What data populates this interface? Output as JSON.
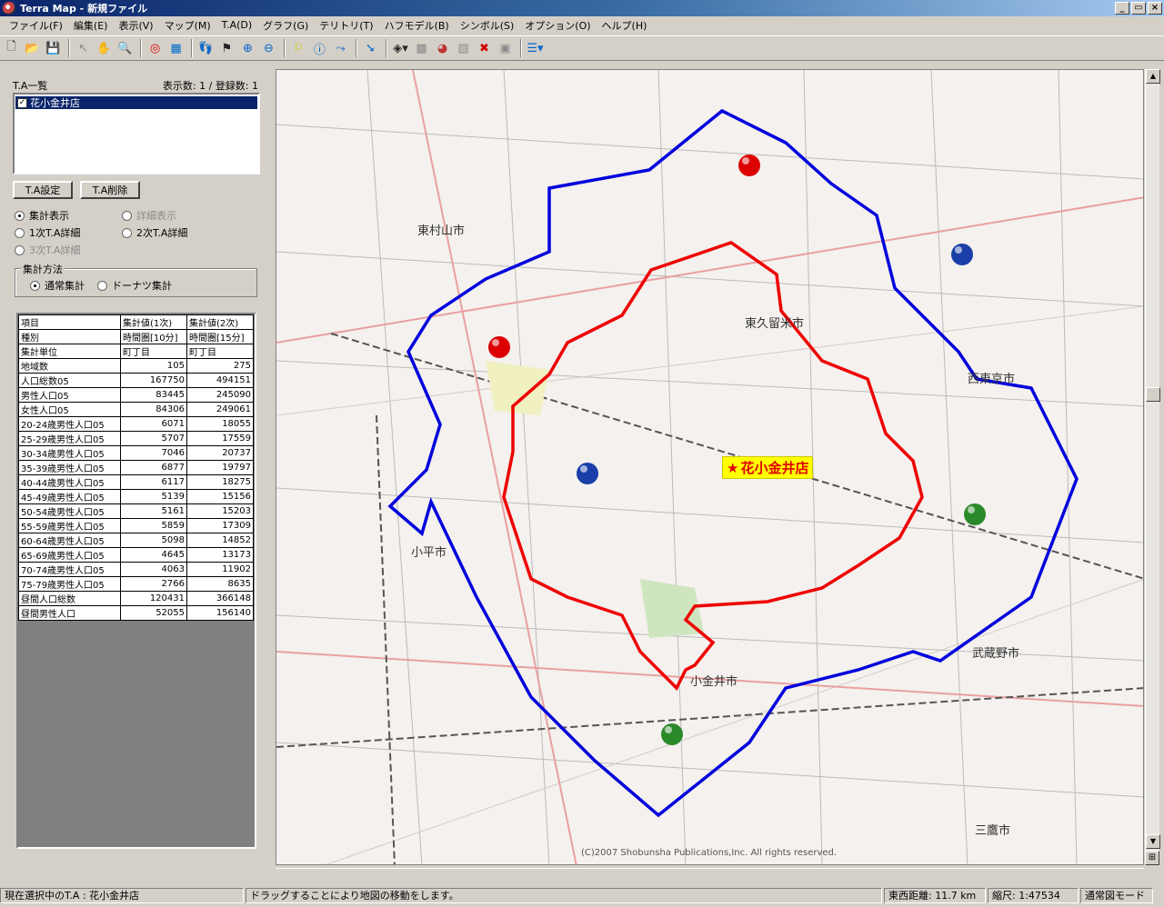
{
  "window": {
    "title": "Terra Map - 新規ファイル",
    "buttons": [
      "_",
      "▭",
      "×"
    ]
  },
  "menu": [
    "ファイル(F)",
    "編集(E)",
    "表示(V)",
    "マップ(M)",
    "T.A(D)",
    "グラフ(G)",
    "テリトリ(T)",
    "ハフモデル(B)",
    "シンボル(S)",
    "オプション(O)",
    "ヘルプ(H)"
  ],
  "toolbar": {
    "icons": [
      "new-file-icon",
      "open-folder-icon",
      "save-icon",
      "select-arrow-icon",
      "hand-pan-icon",
      "magnifier-icon",
      "target-icon",
      "calculator-icon",
      "footprints-icon",
      "signpost-icon",
      "zoom-in-icon",
      "zoom-out-icon",
      "flag-icon",
      "info-icon",
      "route-icon",
      "arrow-down-icon",
      "tag-icon",
      "grid-icon",
      "chart-icon",
      "symbol-icon",
      "cross-icon",
      "export-icon",
      "list-icon"
    ]
  },
  "ta_panel": {
    "title": "T.A一覧",
    "count_label": "表示数: 1 / 登録数: 1",
    "items": [
      {
        "name": "花小金井店",
        "checked": true
      }
    ],
    "btn_set": "T.A設定",
    "btn_delete": "T.A削除",
    "radios": {
      "summary": "集計表示",
      "detail": "詳細表示",
      "first_detail": "1次T.A詳細",
      "second_detail": "2次T.A詳細",
      "third_detail": "3次T.A詳細"
    },
    "method_label": "集計方法",
    "method_normal": "通常集計",
    "method_donut": "ドーナツ集計"
  },
  "stats_table": {
    "headers": [
      "項目",
      "集計値(1次)",
      "集計値(2次)"
    ],
    "rows": [
      [
        "種別",
        "時間圏[10分]",
        "時間圏[15分]"
      ],
      [
        "集計単位",
        "町丁目",
        "町丁目"
      ],
      [
        "地域数",
        "105",
        "275"
      ],
      [
        "人口総数05",
        "167750",
        "494151"
      ],
      [
        "男性人口05",
        "83445",
        "245090"
      ],
      [
        "女性人口05",
        "84306",
        "249061"
      ],
      [
        "20-24歳男性人口05",
        "6071",
        "18055"
      ],
      [
        "25-29歳男性人口05",
        "5707",
        "17559"
      ],
      [
        "30-34歳男性人口05",
        "7046",
        "20737"
      ],
      [
        "35-39歳男性人口05",
        "6877",
        "19797"
      ],
      [
        "40-44歳男性人口05",
        "6117",
        "18275"
      ],
      [
        "45-49歳男性人口05",
        "5139",
        "15156"
      ],
      [
        "50-54歳男性人口05",
        "5161",
        "15203"
      ],
      [
        "55-59歳男性人口05",
        "5859",
        "17309"
      ],
      [
        "60-64歳男性人口05",
        "5098",
        "14852"
      ],
      [
        "65-69歳男性人口05",
        "4645",
        "13173"
      ],
      [
        "70-74歳男性人口05",
        "4063",
        "11902"
      ],
      [
        "75-79歳男性人口05",
        "2766",
        "8635"
      ],
      [
        "昼間人口総数",
        "120431",
        "366148"
      ],
      [
        "昼間男性人口",
        "52055",
        "156140"
      ]
    ]
  },
  "map": {
    "city_labels": [
      "東村山市",
      "東久留米市",
      "西東京市",
      "小平市",
      "小金井市",
      "武蔵野市",
      "三鷹市"
    ],
    "store_label": "花小金井店",
    "copyright": "(C)2007 Shobunsha Publications,Inc. All rights reserved.",
    "colors": {
      "primary_ta": "#ee0000",
      "secondary_ta": "#0000dd",
      "store_bg": "#ffff00"
    }
  },
  "status": {
    "current_ta": "現在選択中のT.A : 花小金井店",
    "hint": "ドラッグすることにより地図の移動をします。",
    "distance": "東西距離: 11.7 km",
    "scale": "縮尺: 1:47534",
    "mode": "通常図モード"
  }
}
